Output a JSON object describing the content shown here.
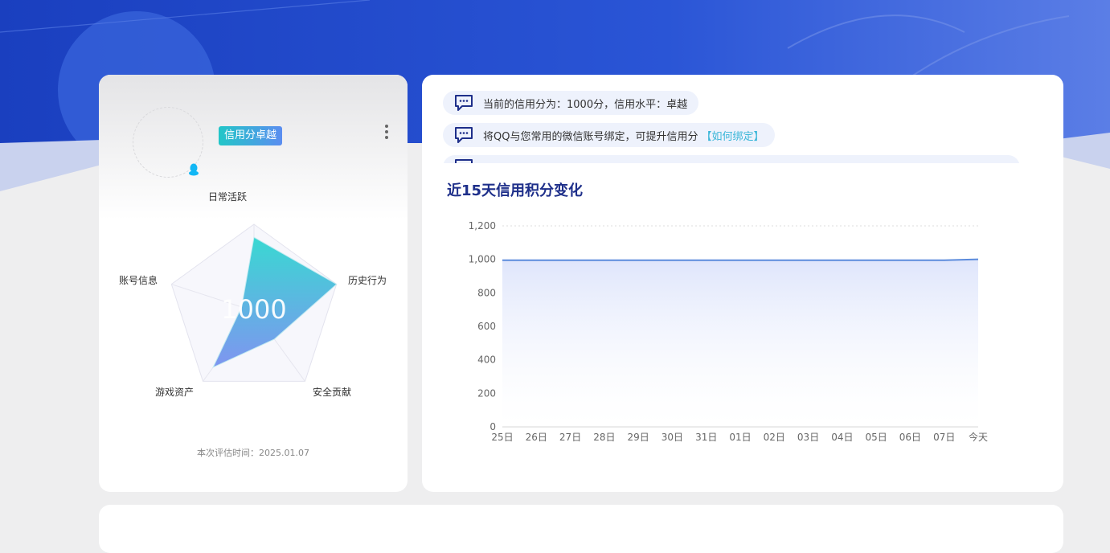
{
  "profile": {
    "level_badge": "信用分卓越",
    "score": "1000",
    "eval_time": "本次评估时间：2025.01.07",
    "radar_labels": {
      "daily": "日常活跃",
      "history": "历史行为",
      "security": "安全贡献",
      "assets": "游戏资产",
      "account": "账号信息"
    },
    "radar_values": {
      "daily": 0.85,
      "history": 1.0,
      "security": 0.4,
      "assets": 0.8,
      "account": 0.15
    }
  },
  "messages": [
    {
      "text": "当前的信用分为：1000分，信用水平：卓越",
      "link": ""
    },
    {
      "text": "将QQ与您常用的微信账号绑定，可提升信用分",
      "link": "【如何绑定】"
    }
  ],
  "chart_data": {
    "type": "area",
    "title": "近15天信用积分变化",
    "categories": [
      "25日",
      "26日",
      "27日",
      "28日",
      "29日",
      "30日",
      "31日",
      "01日",
      "02日",
      "03日",
      "04日",
      "05日",
      "06日",
      "07日",
      "今天"
    ],
    "values": [
      995,
      995,
      995,
      995,
      995,
      995,
      995,
      995,
      995,
      995,
      995,
      995,
      995,
      995,
      1000
    ],
    "ylim": [
      0,
      1200
    ],
    "yticks": [
      "0",
      "200",
      "400",
      "600",
      "800",
      "1,000",
      "1,200"
    ],
    "ytick_values": [
      0,
      200,
      400,
      600,
      800,
      1000,
      1200
    ],
    "color": "#5b8bdc"
  },
  "colors": {
    "banner": "#1e44c8",
    "title": "#1e2f8a",
    "link": "#39b6d8"
  }
}
